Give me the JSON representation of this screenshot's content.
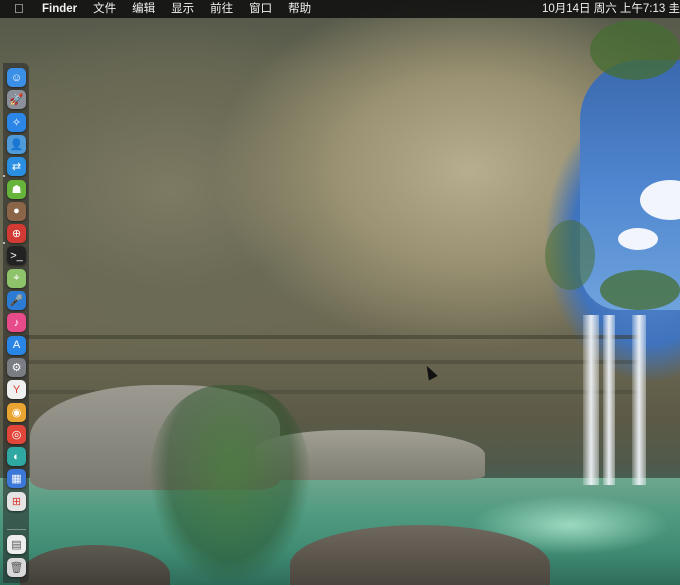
{
  "menubar": {
    "apple_icon": "apple-logo-icon",
    "app_name": "Finder",
    "menus": [
      "文件",
      "编辑",
      "显示",
      "前往",
      "窗口",
      "帮助"
    ],
    "clock": "10月14日 周六 上午7:13",
    "clock_tail": "圭"
  },
  "dock": {
    "apps": [
      {
        "name": "finder-icon",
        "color": "#3b8fe6",
        "glyph": "☺"
      },
      {
        "name": "launchpad-icon",
        "color": "#8a8f99",
        "glyph": "🚀"
      },
      {
        "name": "safari-icon",
        "color": "#2c86e8",
        "glyph": "✧"
      },
      {
        "name": "contacts-icon",
        "color": "#4f9bd9",
        "glyph": "👤"
      },
      {
        "name": "teamviewer-icon",
        "color": "#2a8fe0",
        "glyph": "⇄"
      },
      {
        "name": "android-icon",
        "color": "#67b43a",
        "glyph": "☗"
      },
      {
        "name": "hedgehog-icon",
        "color": "#8a6548",
        "glyph": "●"
      },
      {
        "name": "red-app-icon",
        "color": "#d23b33",
        "glyph": "⊕"
      },
      {
        "name": "terminal-icon",
        "color": "#222222",
        "glyph": ">_"
      },
      {
        "name": "maps-icon",
        "color": "#8fc36b",
        "glyph": "⌖"
      },
      {
        "name": "siri-icon",
        "color": "#2c7cd6",
        "glyph": "🎤"
      },
      {
        "name": "itunes-icon",
        "color": "#e84b8a",
        "glyph": "♪"
      },
      {
        "name": "app-store-icon",
        "color": "#2a86e6",
        "glyph": "A"
      },
      {
        "name": "system-preferences-icon",
        "color": "#7a7d83",
        "glyph": "⚙"
      },
      {
        "name": "yandex-browser-icon",
        "color": "#f0f0f0",
        "glyph": "Y"
      },
      {
        "name": "chrome-icon",
        "color": "#e9a531",
        "glyph": "◉"
      },
      {
        "name": "weibo-icon",
        "color": "#e2463a",
        "glyph": "◎"
      },
      {
        "name": "teal-app-icon",
        "color": "#2ea8a0",
        "glyph": "◐"
      },
      {
        "name": "windows-vm-icon",
        "color": "#3c78d8",
        "glyph": "▦"
      },
      {
        "name": "windows-logo-icon",
        "color": "#e5e5e5",
        "glyph": "⊞"
      }
    ],
    "trailing": [
      {
        "name": "document-icon",
        "color": "#eeeeee",
        "glyph": "▤"
      },
      {
        "name": "trash-icon",
        "color": "#d9d9d9",
        "glyph": "🗑"
      }
    ]
  }
}
